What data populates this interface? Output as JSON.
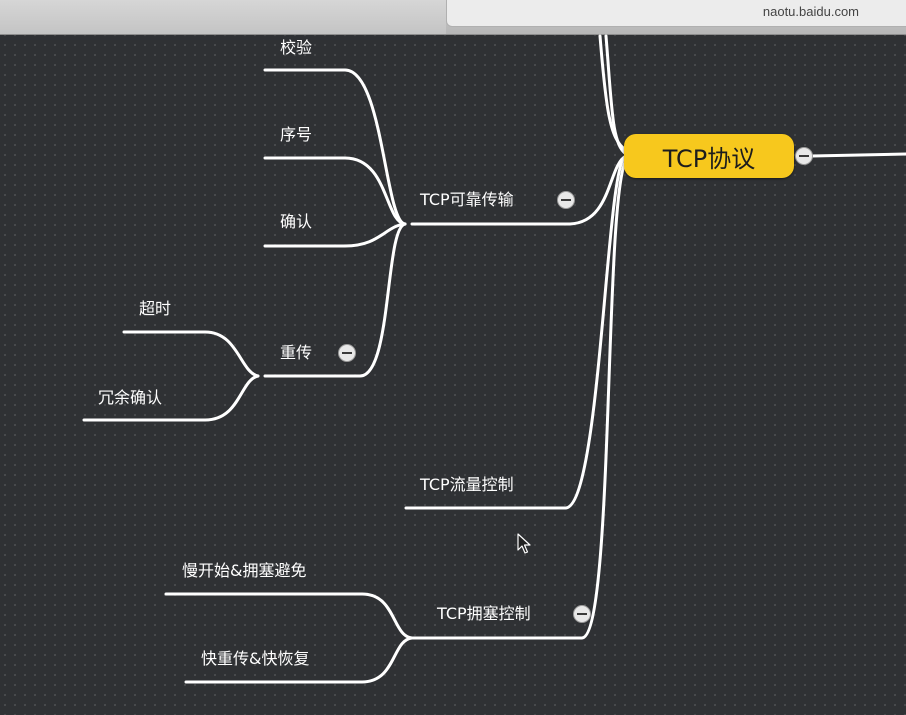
{
  "browser": {
    "url": "naotu.baidu.com"
  },
  "mindmap": {
    "root": "TCP协议",
    "reliable": {
      "label": "TCP可靠传输",
      "children": [
        "校验",
        "序号",
        "确认"
      ],
      "retransmit": {
        "label": "重传",
        "children": [
          "超时",
          "冗余确认"
        ]
      }
    },
    "flow_control": {
      "label": "TCP流量控制"
    },
    "congestion": {
      "label": "TCP拥塞控制",
      "children": [
        "慢开始&拥塞避免",
        "快重传&快恢复"
      ]
    }
  },
  "colors": {
    "root_fill": "#f7c81d",
    "link": "#ffffff",
    "canvas": "#2f3134"
  }
}
